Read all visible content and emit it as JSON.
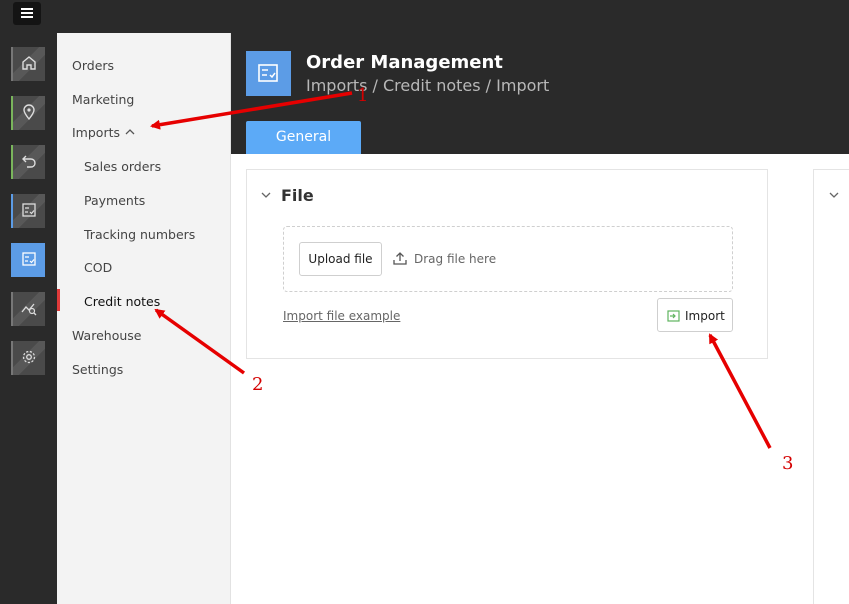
{
  "header": {
    "title": "Order Management",
    "breadcrumb": "Imports / Credit notes / Import",
    "tabs": [
      {
        "label": "General"
      }
    ]
  },
  "sidebar": {
    "items": [
      {
        "label": "Orders"
      },
      {
        "label": "Marketing"
      },
      {
        "label": "Imports"
      },
      {
        "label": "Sales orders"
      },
      {
        "label": "Payments"
      },
      {
        "label": "Tracking numbers"
      },
      {
        "label": "COD"
      },
      {
        "label": "Credit notes"
      },
      {
        "label": "Warehouse"
      },
      {
        "label": "Settings"
      }
    ]
  },
  "rail": {
    "icons": [
      "home-icon",
      "location-pin-icon",
      "return-arrow-icon",
      "checklist-icon",
      "checklist-icon",
      "analytics-icon",
      "gear-icon"
    ],
    "active_color": "#5c9ce6"
  },
  "file_card": {
    "title": "File",
    "upload_label": "Upload file",
    "drag_text": "Drag file here",
    "example_link": "Import file example",
    "import_label": "Import"
  },
  "annotations": {
    "labels": [
      "1",
      "2",
      "3"
    ],
    "color": "#d40000"
  },
  "colors": {
    "accent": "#5caaf7",
    "dark": "#2a2a2a"
  }
}
